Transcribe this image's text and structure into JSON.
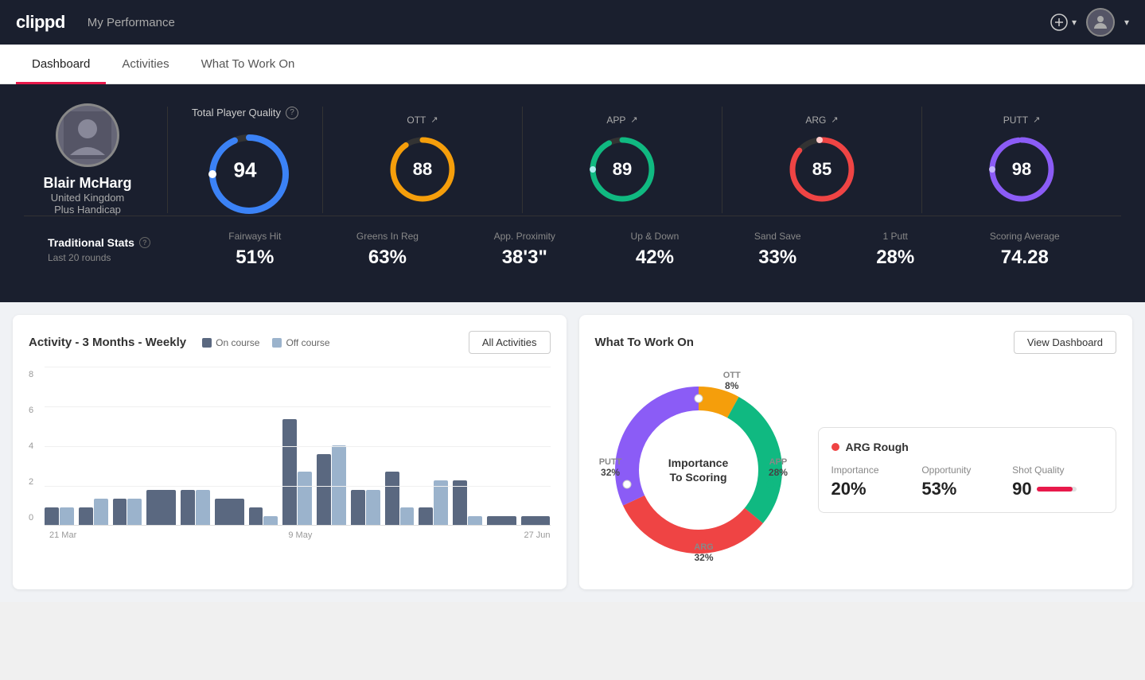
{
  "app": {
    "logo": "clippd",
    "header_title": "My Performance"
  },
  "tabs": [
    {
      "id": "dashboard",
      "label": "Dashboard",
      "active": true
    },
    {
      "id": "activities",
      "label": "Activities",
      "active": false
    },
    {
      "id": "what-to-work-on",
      "label": "What To Work On",
      "active": false
    }
  ],
  "player": {
    "name": "Blair McHarg",
    "country": "United Kingdom",
    "handicap": "Plus Handicap"
  },
  "tpq": {
    "label": "Total Player Quality",
    "value": "94",
    "color": "#3b82f6"
  },
  "stat_blocks": [
    {
      "id": "ott",
      "label": "OTT",
      "value": "88",
      "color": "#f59e0b",
      "arrow": "↗"
    },
    {
      "id": "app",
      "label": "APP",
      "value": "89",
      "color": "#10b981",
      "arrow": "↗"
    },
    {
      "id": "arg",
      "label": "ARG",
      "value": "85",
      "color": "#ef4444",
      "arrow": "↗"
    },
    {
      "id": "putt",
      "label": "PUTT",
      "value": "98",
      "color": "#8b5cf6",
      "arrow": "↗"
    }
  ],
  "trad_stats": {
    "label": "Traditional Stats",
    "sublabel": "Last 20 rounds",
    "items": [
      {
        "label": "Fairways Hit",
        "value": "51%"
      },
      {
        "label": "Greens In Reg",
        "value": "63%"
      },
      {
        "label": "App. Proximity",
        "value": "38'3\""
      },
      {
        "label": "Up & Down",
        "value": "42%"
      },
      {
        "label": "Sand Save",
        "value": "33%"
      },
      {
        "label": "1 Putt",
        "value": "28%"
      },
      {
        "label": "Scoring Average",
        "value": "74.28"
      }
    ]
  },
  "activity_chart": {
    "title": "Activity - 3 Months - Weekly",
    "legend": [
      {
        "label": "On course",
        "color": "#5a6880"
      },
      {
        "label": "Off course",
        "color": "#9bb3cc"
      }
    ],
    "all_activities_label": "All Activities",
    "x_labels": [
      "21 Mar",
      "9 May",
      "27 Jun"
    ],
    "y_labels": [
      "0",
      "2",
      "4",
      "6",
      "8"
    ],
    "bars": [
      {
        "oncourse": 1,
        "offcourse": 1
      },
      {
        "oncourse": 1,
        "offcourse": 1.5
      },
      {
        "oncourse": 1.5,
        "offcourse": 1.5
      },
      {
        "oncourse": 2,
        "offcourse": 0
      },
      {
        "oncourse": 2,
        "offcourse": 2
      },
      {
        "oncourse": 1.5,
        "offcourse": 0
      },
      {
        "oncourse": 1,
        "offcourse": 0.5
      },
      {
        "oncourse": 6,
        "offcourse": 3
      },
      {
        "oncourse": 4,
        "offcourse": 4.5
      },
      {
        "oncourse": 2,
        "offcourse": 2
      },
      {
        "oncourse": 3,
        "offcourse": 1
      },
      {
        "oncourse": 1,
        "offcourse": 2.5
      },
      {
        "oncourse": 2.5,
        "offcourse": 0.5
      },
      {
        "oncourse": 0.5,
        "offcourse": 0
      },
      {
        "oncourse": 0.5,
        "offcourse": 0
      }
    ],
    "max_val": 9
  },
  "what_to_work_on": {
    "title": "What To Work On",
    "view_dashboard_label": "View Dashboard",
    "donut_label_line1": "Importance",
    "donut_label_line2": "To Scoring",
    "segments": [
      {
        "id": "ott",
        "label": "OTT",
        "value": 8,
        "color": "#f59e0b",
        "pct_text": "8%",
        "pos_top": "8%",
        "pos_left": "62%"
      },
      {
        "id": "app",
        "label": "APP",
        "value": 28,
        "color": "#10b981",
        "pct_text": "28%",
        "pos_top": "48%",
        "pos_left": "88%"
      },
      {
        "id": "arg",
        "label": "ARG",
        "value": 32,
        "color": "#ef4444",
        "pct_text": "32%",
        "pos_top": "88%",
        "pos_left": "52%"
      },
      {
        "id": "putt",
        "label": "PUTT",
        "value": 32,
        "color": "#8b5cf6",
        "pct_text": "32%",
        "pos_top": "48%",
        "pos_left": "4%"
      }
    ],
    "info_card": {
      "title": "ARG Rough",
      "dot_color": "#ef4444",
      "metrics": [
        {
          "label": "Importance",
          "value": "20%"
        },
        {
          "label": "Opportunity",
          "value": "53%"
        },
        {
          "label": "Shot Quality",
          "value": "90",
          "has_bar": true,
          "bar_pct": 90
        }
      ]
    }
  }
}
